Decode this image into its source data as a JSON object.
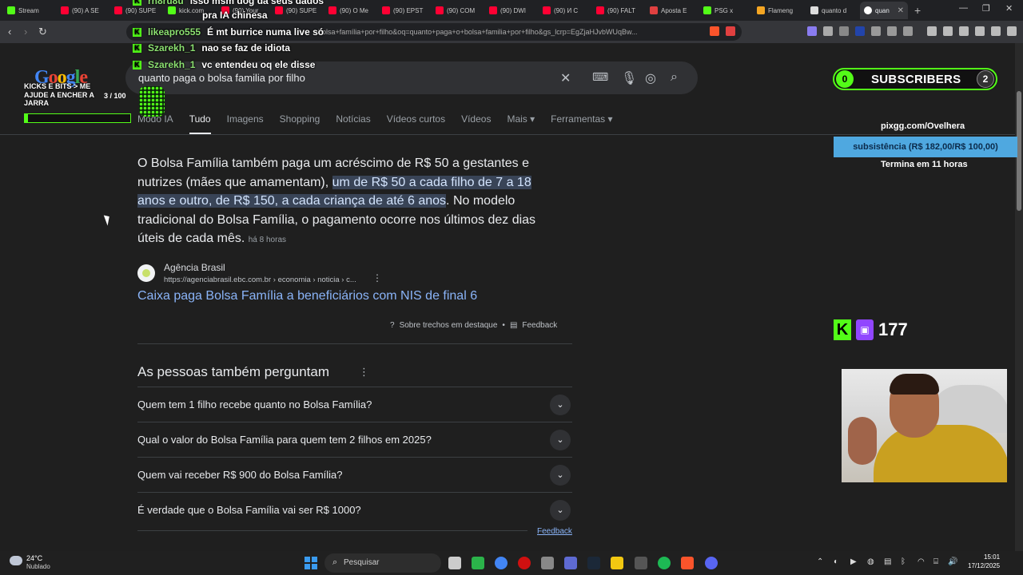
{
  "browser": {
    "tabs": [
      {
        "label": "Stream",
        "color": "#53fc18"
      },
      {
        "label": "(90) A SE",
        "color": "#ff0033"
      },
      {
        "label": "(90) SUPE",
        "color": "#ff0033"
      },
      {
        "label": "kick.com",
        "color": "#53fc18"
      },
      {
        "label": "(90) Your",
        "color": "#ff0033"
      },
      {
        "label": "(90) SUPE",
        "color": "#ff0033"
      },
      {
        "label": "(90) O Me",
        "color": "#ff0033"
      },
      {
        "label": "(90) EPST",
        "color": "#ff0033"
      },
      {
        "label": "(90) COM",
        "color": "#ff0033"
      },
      {
        "label": "(90) DWI",
        "color": "#ff0033"
      },
      {
        "label": "(90) И С",
        "color": "#ff0033"
      },
      {
        "label": "(90) FALT",
        "color": "#ff0033"
      },
      {
        "label": "Aposta E",
        "color": "#e04040"
      },
      {
        "label": "PSG x",
        "color": "#53fc18"
      },
      {
        "label": "Flameng",
        "color": "#f5a623"
      },
      {
        "label": "quanto d",
        "color": "#dddddd"
      }
    ],
    "active_tab": "quan",
    "address": "bolsa+família+por+filho&oq=quanto+paga+o+bolsa+familia+por+filho&gs_lcrp=EgZjaHJvbWUqBw..."
  },
  "google": {
    "logo": "Google",
    "query": "quanto paga o bolsa familia por filho",
    "tabs": [
      "Modo IA",
      "Tudo",
      "Imagens",
      "Shopping",
      "Notícias",
      "Vídeos curtos",
      "Vídeos",
      "Mais ▾",
      "Ferramentas ▾"
    ],
    "active_tab_index": 1
  },
  "snippet": {
    "text_before": "O Bolsa Família também paga um acréscimo de R$ 50 a gestantes e nutrizes (mães que amamentam), ",
    "text_highlight": "um de R$ 50 a cada filho de 7 a 18 anos e outro, de R$ 150, a cada criança de até 6 anos",
    "text_after": ". No modelo tradicional do Bolsa Família, o pagamento ocorre nos últimos dez dias úteis de cada mês.",
    "ago": "há 8 horas",
    "source_name": "Agência Brasil",
    "source_url": "https://agenciabrasil.ebc.com.br › economia › noticia › c...",
    "title": "Caixa paga Bolsa Família a beneficiários com NIS de final 6",
    "about_label": "Sobre trechos em destaque",
    "separator": "•",
    "feedback_label": "Feedback"
  },
  "paa": {
    "title": "As pessoas também perguntam",
    "questions": [
      "Quem tem 1 filho recebe quanto no Bolsa Família?",
      "Qual o valor do Bolsa Família para quem tem 2 filhos em 2025?",
      "Quem vai receber R$ 900 do Bolsa Família?",
      "É verdade que o Bolsa Família vai ser R$ 1000?"
    ],
    "feedback_label": "Feedback"
  },
  "chat": [
    {
      "user": "rn8ru8u",
      "msg": "isso msm dog da seus dados"
    },
    {
      "user": "",
      "msg": "pra IA chinesa"
    },
    {
      "user": "likeapro555",
      "msg": "É mt burrice numa live só"
    },
    {
      "user": "Szarekh_1",
      "msg": "nao se faz de idiota"
    },
    {
      "user": "Szarekh_1",
      "msg": "vc entendeu oq ele disse"
    }
  ],
  "goal": {
    "text": "KICKS E BITS > ME AJUDE A ENCHER A JARRA",
    "count": "3 / 100",
    "fraction": 0.03
  },
  "subs": {
    "count": "0",
    "label": "SUBSCRIBERS",
    "goal": "2"
  },
  "pix": {
    "url": "pixgg.com/Ovelhera",
    "label": "subsistência (R$ 182,00/R$ 100,00)",
    "fraction": 1.0,
    "ends": "Termina em 11 horas"
  },
  "viewers": {
    "count": "177"
  },
  "taskbar": {
    "temp": "24°C",
    "weather": "Nublado",
    "search": "Pesquisar",
    "time": "15:01",
    "date": "17/12/2025"
  }
}
